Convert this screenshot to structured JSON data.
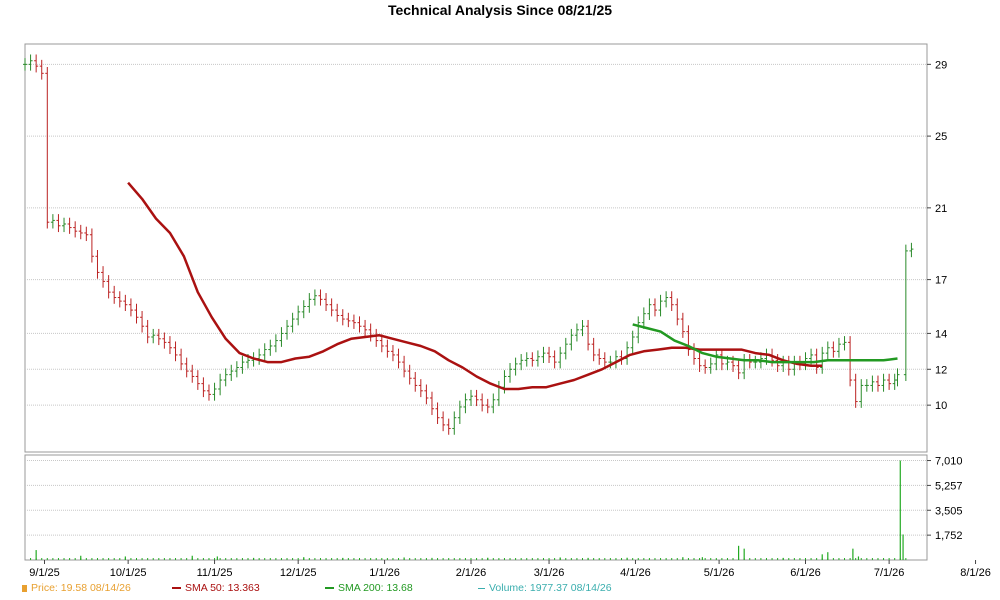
{
  "chart_data": {
    "type": "line",
    "title": "Technical Analysis Since 08/21/25",
    "price_axis": {
      "ylim": [
        7.5,
        29.8
      ],
      "ticks": [
        10,
        12,
        14,
        17,
        21,
        25,
        29
      ]
    },
    "volume_axis": {
      "ylim": [
        0,
        7400
      ],
      "ticks": [
        "1,752",
        "3,505",
        "5,257",
        "7,010"
      ],
      "tick_values": [
        1752,
        3505,
        5257,
        7010
      ]
    },
    "x_ticks": [
      "9/1/25",
      "10/1/25",
      "11/1/25",
      "12/1/25",
      "1/1/26",
      "2/1/26",
      "3/1/26",
      "4/1/26",
      "5/1/26",
      "6/1/26",
      "7/1/26",
      "8/1/26"
    ],
    "x_tick_days": [
      11,
      41,
      72,
      102,
      133,
      164,
      192,
      223,
      253,
      284,
      314,
      345
    ],
    "grid": true,
    "series": [
      {
        "name": "Price",
        "style": "ohlc",
        "color": "#cc8800",
        "points": [
          [
            4,
            29.0
          ],
          [
            6,
            29.2
          ],
          [
            8,
            28.9
          ],
          [
            10,
            28.5
          ],
          [
            12,
            20.2
          ],
          [
            14,
            20.3
          ],
          [
            16,
            20.0
          ],
          [
            18,
            20.1
          ],
          [
            20,
            19.9
          ],
          [
            22,
            19.7
          ],
          [
            24,
            19.6
          ],
          [
            26,
            19.5
          ],
          [
            28,
            18.3
          ],
          [
            30,
            17.4
          ],
          [
            32,
            16.9
          ],
          [
            34,
            16.3
          ],
          [
            36,
            16.0
          ],
          [
            38,
            15.8
          ],
          [
            40,
            15.6
          ],
          [
            42,
            15.3
          ],
          [
            44,
            14.9
          ],
          [
            46,
            14.4
          ],
          [
            48,
            13.8
          ],
          [
            50,
            13.9
          ],
          [
            52,
            13.7
          ],
          [
            54,
            13.5
          ],
          [
            56,
            13.2
          ],
          [
            58,
            12.8
          ],
          [
            60,
            12.3
          ],
          [
            62,
            11.9
          ],
          [
            64,
            11.6
          ],
          [
            66,
            11.2
          ],
          [
            68,
            10.8
          ],
          [
            70,
            10.6
          ],
          [
            72,
            10.9
          ],
          [
            74,
            11.4
          ],
          [
            76,
            11.7
          ],
          [
            78,
            11.9
          ],
          [
            80,
            12.1
          ],
          [
            82,
            12.4
          ],
          [
            84,
            12.5
          ],
          [
            86,
            12.6
          ],
          [
            88,
            12.8
          ],
          [
            90,
            13.1
          ],
          [
            92,
            13.3
          ],
          [
            94,
            13.6
          ],
          [
            96,
            14.0
          ],
          [
            98,
            14.4
          ],
          [
            100,
            14.8
          ],
          [
            102,
            15.2
          ],
          [
            104,
            15.5
          ],
          [
            106,
            15.9
          ],
          [
            108,
            16.1
          ],
          [
            110,
            15.9
          ],
          [
            112,
            15.6
          ],
          [
            114,
            15.3
          ],
          [
            116,
            15.0
          ],
          [
            118,
            14.8
          ],
          [
            120,
            14.7
          ],
          [
            122,
            14.6
          ],
          [
            124,
            14.4
          ],
          [
            126,
            14.2
          ],
          [
            128,
            13.9
          ],
          [
            130,
            13.6
          ],
          [
            132,
            13.3
          ],
          [
            134,
            13.0
          ],
          [
            136,
            12.8
          ],
          [
            138,
            12.4
          ],
          [
            140,
            11.9
          ],
          [
            142,
            11.5
          ],
          [
            144,
            11.1
          ],
          [
            146,
            10.8
          ],
          [
            148,
            10.4
          ],
          [
            150,
            9.8
          ],
          [
            152,
            9.3
          ],
          [
            154,
            8.9
          ],
          [
            156,
            8.7
          ],
          [
            158,
            9.3
          ],
          [
            160,
            9.9
          ],
          [
            162,
            10.3
          ],
          [
            164,
            10.5
          ],
          [
            166,
            10.3
          ],
          [
            168,
            10.0
          ],
          [
            170,
            9.9
          ],
          [
            172,
            10.3
          ],
          [
            174,
            11.0
          ],
          [
            176,
            11.6
          ],
          [
            178,
            12.0
          ],
          [
            180,
            12.3
          ],
          [
            182,
            12.5
          ],
          [
            184,
            12.6
          ],
          [
            186,
            12.5
          ],
          [
            188,
            12.7
          ],
          [
            190,
            12.9
          ],
          [
            192,
            12.7
          ],
          [
            194,
            12.4
          ],
          [
            196,
            12.9
          ],
          [
            198,
            13.4
          ],
          [
            200,
            13.9
          ],
          [
            202,
            14.2
          ],
          [
            204,
            14.4
          ],
          [
            206,
            13.4
          ],
          [
            208,
            12.8
          ],
          [
            210,
            12.6
          ],
          [
            212,
            12.4
          ],
          [
            214,
            12.4
          ],
          [
            216,
            12.7
          ],
          [
            218,
            12.6
          ],
          [
            220,
            13.2
          ],
          [
            222,
            13.8
          ],
          [
            224,
            14.6
          ],
          [
            226,
            15.1
          ],
          [
            228,
            15.6
          ],
          [
            230,
            15.3
          ],
          [
            232,
            15.8
          ],
          [
            234,
            16.0
          ],
          [
            236,
            15.6
          ],
          [
            238,
            14.8
          ],
          [
            240,
            14.1
          ],
          [
            242,
            13.1
          ],
          [
            244,
            12.6
          ],
          [
            246,
            12.2
          ],
          [
            248,
            12.1
          ],
          [
            250,
            12.3
          ],
          [
            252,
            12.8
          ],
          [
            254,
            12.3
          ],
          [
            256,
            12.4
          ],
          [
            258,
            12.2
          ],
          [
            260,
            11.8
          ],
          [
            262,
            12.5
          ],
          [
            264,
            12.4
          ],
          [
            266,
            12.4
          ],
          [
            268,
            12.6
          ],
          [
            270,
            12.8
          ],
          [
            272,
            12.5
          ],
          [
            274,
            12.2
          ],
          [
            276,
            12.4
          ],
          [
            278,
            12.0
          ],
          [
            280,
            12.4
          ],
          [
            282,
            12.3
          ],
          [
            284,
            12.6
          ],
          [
            286,
            12.8
          ],
          [
            288,
            12.1
          ],
          [
            290,
            12.9
          ],
          [
            292,
            13.2
          ],
          [
            294,
            13.0
          ],
          [
            296,
            13.4
          ],
          [
            298,
            13.5
          ],
          [
            300,
            11.4
          ],
          [
            302,
            10.2
          ],
          [
            304,
            11.1
          ],
          [
            306,
            11.1
          ],
          [
            308,
            11.3
          ],
          [
            310,
            11.1
          ],
          [
            312,
            11.4
          ],
          [
            314,
            11.2
          ],
          [
            316,
            11.4
          ],
          [
            317,
            11.7
          ],
          [
            320,
            18.6
          ],
          [
            322,
            18.7
          ]
        ]
      },
      {
        "name": "SMA 50",
        "color": "#aa1111",
        "points": [
          [
            41,
            22.4
          ],
          [
            46,
            21.5
          ],
          [
            51,
            20.4
          ],
          [
            56,
            19.6
          ],
          [
            61,
            18.3
          ],
          [
            66,
            16.3
          ],
          [
            71,
            14.9
          ],
          [
            76,
            13.7
          ],
          [
            81,
            12.9
          ],
          [
            86,
            12.6
          ],
          [
            91,
            12.4
          ],
          [
            96,
            12.4
          ],
          [
            101,
            12.6
          ],
          [
            106,
            12.7
          ],
          [
            111,
            13.0
          ],
          [
            116,
            13.4
          ],
          [
            121,
            13.7
          ],
          [
            126,
            13.8
          ],
          [
            131,
            13.9
          ],
          [
            136,
            13.7
          ],
          [
            141,
            13.5
          ],
          [
            146,
            13.3
          ],
          [
            151,
            13.0
          ],
          [
            156,
            12.5
          ],
          [
            161,
            12.1
          ],
          [
            166,
            11.6
          ],
          [
            171,
            11.2
          ],
          [
            176,
            10.9
          ],
          [
            181,
            10.9
          ],
          [
            186,
            11.0
          ],
          [
            191,
            11.0
          ],
          [
            196,
            11.2
          ],
          [
            201,
            11.4
          ],
          [
            206,
            11.7
          ],
          [
            211,
            12.0
          ],
          [
            216,
            12.4
          ],
          [
            221,
            12.8
          ],
          [
            226,
            13.0
          ],
          [
            231,
            13.1
          ],
          [
            236,
            13.2
          ],
          [
            241,
            13.2
          ],
          [
            246,
            13.1
          ],
          [
            251,
            13.1
          ],
          [
            256,
            13.1
          ],
          [
            261,
            13.1
          ],
          [
            266,
            12.9
          ],
          [
            271,
            12.8
          ],
          [
            276,
            12.5
          ],
          [
            281,
            12.3
          ],
          [
            286,
            12.2
          ],
          [
            290,
            12.2
          ]
        ]
      },
      {
        "name": "SMA 200",
        "color": "#229922",
        "points": [
          [
            222,
            14.5
          ],
          [
            227,
            14.3
          ],
          [
            232,
            14.1
          ],
          [
            237,
            13.6
          ],
          [
            242,
            13.3
          ],
          [
            247,
            12.9
          ],
          [
            252,
            12.7
          ],
          [
            257,
            12.6
          ],
          [
            262,
            12.5
          ],
          [
            267,
            12.5
          ],
          [
            272,
            12.4
          ],
          [
            277,
            12.4
          ],
          [
            282,
            12.4
          ],
          [
            287,
            12.4
          ],
          [
            292,
            12.5
          ],
          [
            297,
            12.5
          ],
          [
            302,
            12.5
          ],
          [
            307,
            12.5
          ],
          [
            312,
            12.5
          ],
          [
            317,
            12.6
          ]
        ]
      },
      {
        "name": "Volume",
        "style": "bar",
        "color": "#22aa22",
        "bars": [
          [
            8,
            700
          ],
          [
            24,
            300
          ],
          [
            40,
            250
          ],
          [
            64,
            300
          ],
          [
            73,
            250
          ],
          [
            86,
            150
          ],
          [
            104,
            200
          ],
          [
            118,
            150
          ],
          [
            140,
            180
          ],
          [
            150,
            150
          ],
          [
            170,
            160
          ],
          [
            196,
            180
          ],
          [
            206,
            150
          ],
          [
            220,
            160
          ],
          [
            240,
            200
          ],
          [
            247,
            200
          ],
          [
            260,
            1000
          ],
          [
            262,
            800
          ],
          [
            276,
            150
          ],
          [
            290,
            400
          ],
          [
            292,
            550
          ],
          [
            301,
            800
          ],
          [
            303,
            250
          ],
          [
            318,
            7010
          ],
          [
            319,
            1800
          ]
        ]
      }
    ]
  },
  "legend": {
    "price": "Price: 19.58  08/14/26",
    "sma50": "SMA 50: 13.363",
    "sma200": "SMA 200: 13.68",
    "volume": "Volume: 1977.37  08/14/26",
    "price_color": "#e8a030",
    "sma50_color": "#aa1111",
    "sma200_color": "#229922",
    "volume_color": "#3aaeae"
  }
}
